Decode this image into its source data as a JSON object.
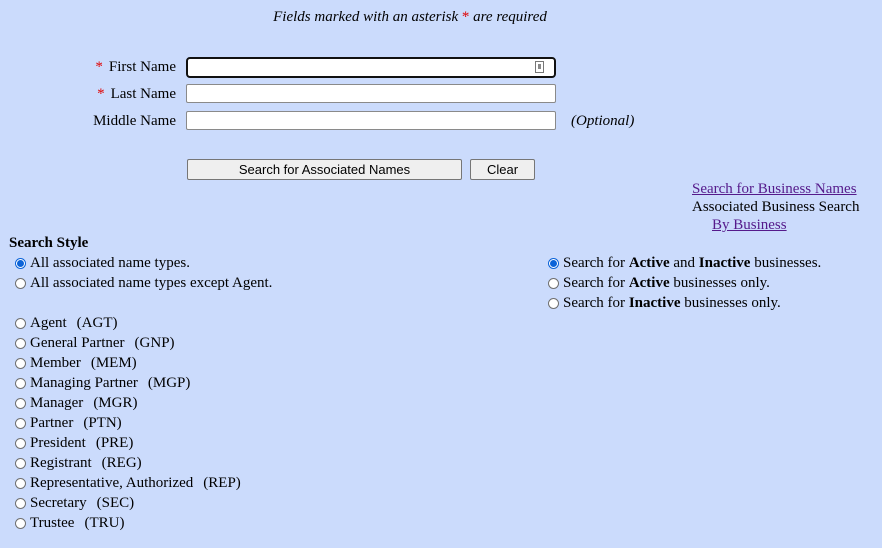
{
  "notice": {
    "prefix": "Fields marked with an asterisk",
    "star": "*",
    "suffix": "are required"
  },
  "form": {
    "first_name_label": "First Name",
    "last_name_label": "Last Name",
    "middle_name_label": "Middle Name",
    "required_star": "*",
    "optional_text": "(Optional)",
    "first_name_value": "",
    "last_name_value": "",
    "middle_name_value": ""
  },
  "buttons": {
    "search": "Search for Associated Names",
    "clear": "Clear"
  },
  "right_nav": {
    "business_names_link": "Search for Business Names",
    "associated_text": "Associated Business Search",
    "by_business_link": "By Business"
  },
  "search_style": {
    "heading": "Search Style",
    "all_types": "All associated name types.",
    "all_except_agent": "All associated name types except Agent.",
    "selected": "all_types"
  },
  "status_options": [
    {
      "pre": "Search for ",
      "b1": "Active",
      "mid": " and ",
      "b2": "Inactive",
      "post": " businesses.",
      "checked": true
    },
    {
      "pre": "Search for ",
      "b1": "Active",
      "mid": "",
      "b2": "",
      "post": " businesses only.",
      "checked": false
    },
    {
      "pre": "Search for ",
      "b1": "Inactive",
      "mid": "",
      "b2": "",
      "post": " businesses only.",
      "checked": false
    }
  ],
  "name_types": [
    {
      "label": "Agent",
      "code": "(AGT)"
    },
    {
      "label": "General Partner",
      "code": "(GNP)"
    },
    {
      "label": "Member",
      "code": "(MEM)"
    },
    {
      "label": "Managing Partner",
      "code": "(MGP)"
    },
    {
      "label": "Manager",
      "code": "(MGR)"
    },
    {
      "label": "Partner",
      "code": "(PTN)"
    },
    {
      "label": "President",
      "code": "(PRE)"
    },
    {
      "label": "Registrant",
      "code": "(REG)"
    },
    {
      "label": "Representative, Authorized",
      "code": "(REP)"
    },
    {
      "label": "Secretary",
      "code": "(SEC)"
    },
    {
      "label": "Trustee",
      "code": "(TRU)"
    }
  ],
  "colors": {
    "background": "#cbdbfc",
    "required": "#e00000",
    "link": "#551a8b",
    "radio_checked": "#0b63d8"
  }
}
